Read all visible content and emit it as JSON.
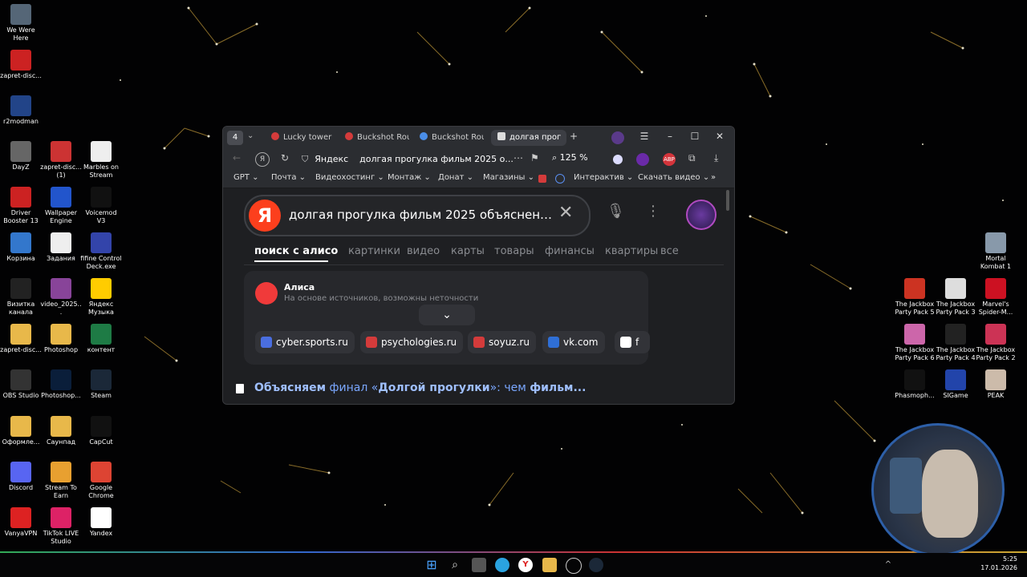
{
  "desktop": {
    "left_icons": [
      {
        "label": "We Were Here",
        "icon": "game-icon",
        "color": "#556677"
      },
      {
        "label": "zapret-disc...",
        "icon": "batch-icon",
        "color": "#cc2222"
      },
      {
        "label": "r2modman",
        "icon": "r2-icon",
        "color": "#224488"
      },
      {
        "label": "DayZ",
        "icon": "dayz-icon",
        "color": "#666666"
      },
      {
        "label": "zapret-disc... (1)",
        "icon": "batch-icon",
        "color": "#cc3333"
      },
      {
        "label": "Marbles on Stream",
        "icon": "marbles-icon",
        "color": "#eeeeee"
      },
      {
        "label": "Driver Booster 13",
        "icon": "driver-booster-icon",
        "color": "#cc2222"
      },
      {
        "label": "Wallpaper Engine",
        "icon": "wallpaper-engine-icon",
        "color": "#2255cc"
      },
      {
        "label": "Voicemod V3",
        "icon": "voicemod-icon",
        "color": "#111111"
      },
      {
        "label": "Корзина",
        "icon": "recycle-bin-icon",
        "color": "#3377cc"
      },
      {
        "label": "Задания",
        "icon": "document-icon",
        "color": "#eeeeee"
      },
      {
        "label": "fifine Control Deck.exe",
        "icon": "fifine-icon",
        "color": "#3344aa"
      },
      {
        "label": "Визитка канала",
        "icon": "video-file-icon",
        "color": "#222222"
      },
      {
        "label": "video_2025...",
        "icon": "video-file-icon",
        "color": "#884499"
      },
      {
        "label": "Яндекс Музыка",
        "icon": "yandex-music-icon",
        "color": "#ffcc00"
      },
      {
        "label": "zapret-disc...",
        "icon": "folder-icon",
        "color": "#e8b84a"
      },
      {
        "label": "Photoshop",
        "icon": "folder-icon",
        "color": "#e8b84a"
      },
      {
        "label": "контент",
        "icon": "excel-icon",
        "color": "#1e7b45"
      },
      {
        "label": "OBS Studio",
        "icon": "obs-icon",
        "color": "#333333"
      },
      {
        "label": "Photoshop...",
        "icon": "photoshop-icon",
        "color": "#0a1e3a"
      },
      {
        "label": "Steam",
        "icon": "steam-icon",
        "color": "#1b2838"
      },
      {
        "label": "Оформле...",
        "icon": "folder-icon",
        "color": "#e8b84a"
      },
      {
        "label": "Саунпад",
        "icon": "folder-icon",
        "color": "#e8b84a"
      },
      {
        "label": "CapCut",
        "icon": "capcut-icon",
        "color": "#111111"
      },
      {
        "label": "Discord",
        "icon": "discord-icon",
        "color": "#5865f2"
      },
      {
        "label": "Stream To Earn",
        "icon": "stream-earn-icon",
        "color": "#e8a030"
      },
      {
        "label": "Google Chrome",
        "icon": "chrome-icon",
        "color": "#dd4433"
      },
      {
        "label": "VanyaVPN",
        "icon": "vpn-icon",
        "color": "#dd2222"
      },
      {
        "label": "TikTok LIVE Studio",
        "icon": "tiktok-icon",
        "color": "#dd2266"
      },
      {
        "label": "Yandex",
        "icon": "yandex-browser-icon",
        "color": "#ffffff"
      }
    ],
    "right_icons": [
      {
        "label": "Mortal Kombat 1",
        "icon": "mk-icon",
        "color": "#8899aa"
      },
      {
        "label": "The Jackbox Party Pack 5",
        "icon": "jackbox-icon",
        "color": "#cc3322"
      },
      {
        "label": "The Jackbox Party Pack 3",
        "icon": "jackbox-icon",
        "color": "#dddddd"
      },
      {
        "label": "Marvel's Spider-M...",
        "icon": "spiderman-icon",
        "color": "#cc1122"
      },
      {
        "label": "The Jackbox Party Pack 6",
        "icon": "jackbox-icon",
        "color": "#cc66aa"
      },
      {
        "label": "The Jackbox Party Pack 4",
        "icon": "jackbox-icon",
        "color": "#222222"
      },
      {
        "label": "The Jackbox Party Pack 2",
        "icon": "jackbox-icon",
        "color": "#cc3355"
      },
      {
        "label": "Phasmoph...",
        "icon": "phasmophobia-icon",
        "color": "#111111"
      },
      {
        "label": "SIGame",
        "icon": "sigame-icon",
        "color": "#2244aa"
      },
      {
        "label": "PEAK",
        "icon": "peak-icon",
        "color": "#ccbbaa"
      }
    ]
  },
  "browser": {
    "tab_count": "4",
    "tabs": [
      {
        "label": "Lucky tower",
        "color": "#d43b3b"
      },
      {
        "label": "Buckshot Rou",
        "color": "#d43b3b"
      },
      {
        "label": "Buckshot Rou",
        "color": "#4a8ee8"
      },
      {
        "label": "долгая прог",
        "color": "#dddddd"
      }
    ],
    "toolbar": {
      "site": "Яндекс",
      "address": "долгая прогулка фильм 2025 о...",
      "zoom": "125 %"
    },
    "bookmarks": [
      "GPT",
      "Почта",
      "Видеохостинг",
      "Монтаж",
      "Донат",
      "Магазины",
      "Интерактив",
      "Скачать видео"
    ],
    "search": {
      "logo": "Я",
      "query": "долгая прогулка фильм 2025 объяснени..."
    },
    "nav_tabs": [
      "поиск с алисо",
      "картинки",
      "видео",
      "карты",
      "товары",
      "финансы",
      "квартиры",
      "все"
    ],
    "alisa": {
      "title": "Алиса",
      "subtitle": "На основе источников, возможны неточности",
      "sources": [
        {
          "label": "cyber.sports.ru",
          "color": "#4a6ee0"
        },
        {
          "label": "psychologies.ru",
          "color": "#d43b3b"
        },
        {
          "label": "soyuz.ru",
          "color": "#d43b3b"
        },
        {
          "label": "vk.com",
          "color": "#2f6fd6"
        },
        {
          "label": "f",
          "color": "#ffffff"
        }
      ]
    },
    "result": {
      "t1": "Объясняем",
      "t2": " финал «",
      "t3": "Долгой прогулки",
      "t4": "»: чем ",
      "t5": "фильм..."
    }
  },
  "taskbar": {
    "time": "5:25",
    "date": "17.01.2026"
  }
}
